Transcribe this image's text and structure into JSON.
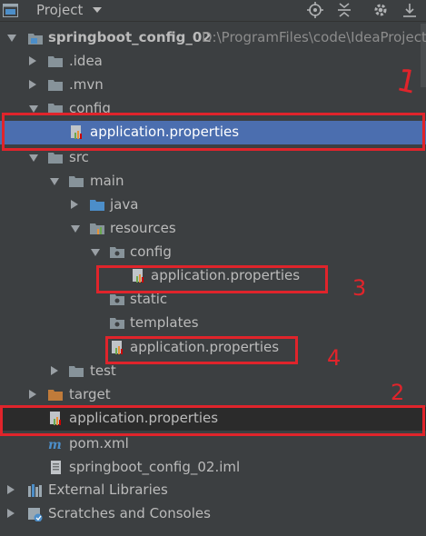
{
  "header": {
    "title": "Project",
    "icons": [
      "project-view-icon",
      "locate-icon",
      "collapse-all-icon",
      "settings-icon",
      "hide-icon"
    ]
  },
  "tree": {
    "root_label": "springboot_config_02",
    "root_path": "D:\\ProgramFiles\\code\\IdeaProject",
    "idea": ".idea",
    "mvn": ".mvn",
    "config": "config",
    "config_app_props": "application.properties",
    "src": "src",
    "main": "main",
    "java": "java",
    "resources": "resources",
    "res_config": "config",
    "res_config_app_props": "application.properties",
    "static": "static",
    "templates": "templates",
    "res_app_props": "application.properties",
    "test": "test",
    "target": "target",
    "root_app_props": "application.properties",
    "pom": "pom.xml",
    "iml": "springboot_config_02.iml",
    "external_libraries": "External Libraries",
    "scratches": "Scratches and Consoles"
  },
  "annotations": {
    "mark1": "1",
    "mark2": "2",
    "mark3": "3",
    "mark4": "4",
    "color": "#e0242b"
  },
  "colors": {
    "background": "#3c3f41",
    "selection": "#4b6eaf",
    "folder": "#87939a",
    "target_folder": "#c07b3a",
    "source_folder": "#4c8ec9"
  }
}
